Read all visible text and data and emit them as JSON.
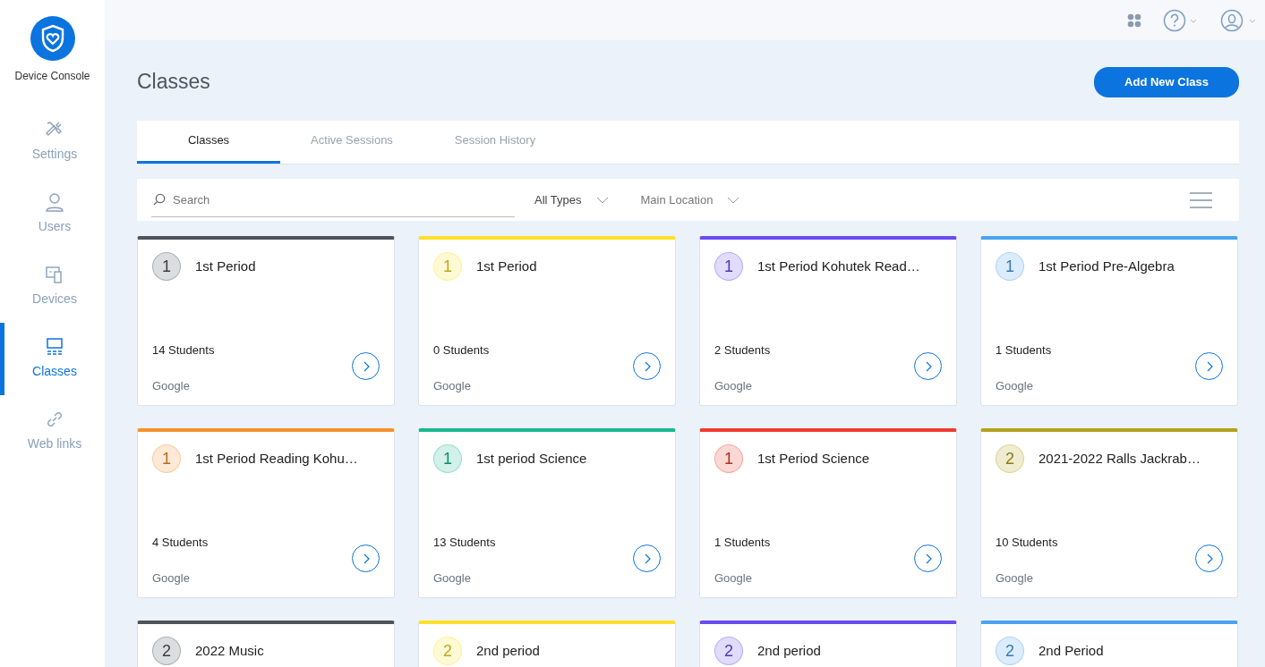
{
  "brand": {
    "name": "Device Console"
  },
  "sidebar": {
    "items": [
      {
        "label": "Settings",
        "selected": false
      },
      {
        "label": "Users",
        "selected": false
      },
      {
        "label": "Devices",
        "selected": false
      },
      {
        "label": "Classes",
        "selected": true
      },
      {
        "label": "Web links",
        "selected": false
      }
    ]
  },
  "page_title": "Classes",
  "add_button": "Add New Class",
  "tabs": [
    {
      "label": "Classes",
      "selected": true
    },
    {
      "label": "Active Sessions",
      "selected": false
    },
    {
      "label": "Session History",
      "selected": false
    }
  ],
  "filters": {
    "search_placeholder": "Search",
    "type": "All Types",
    "location": "Main Location"
  },
  "classes": [
    {
      "number": "1",
      "name": "1st Period",
      "students": "14 Students",
      "provider": "Google",
      "color": "#4b545c"
    },
    {
      "number": "1",
      "name": "1st Period",
      "students": "0 Students",
      "provider": "Google",
      "color": "#fde02a"
    },
    {
      "number": "1",
      "name": "1st Period Kohutek Read…",
      "students": "2 Students",
      "provider": "Google",
      "color": "#6a4cf0"
    },
    {
      "number": "1",
      "name": "1st Period Pre-Algebra",
      "students": "1 Students",
      "provider": "Google",
      "color": "#4aa3f0"
    },
    {
      "number": "1",
      "name": "1st Period Reading Kohu…",
      "students": "4 Students",
      "provider": "Google",
      "color": "#f7912b"
    },
    {
      "number": "1",
      "name": "1st period Science",
      "students": "13 Students",
      "provider": "Google",
      "color": "#17b890"
    },
    {
      "number": "1",
      "name": "1st Period Science",
      "students": "1 Students",
      "provider": "Google",
      "color": "#ef3b2f"
    },
    {
      "number": "2",
      "name": "2021-2022 Ralls Jackrab…",
      "students": "10 Students",
      "provider": "Google",
      "color": "#b5a21a"
    },
    {
      "number": "2",
      "name": "2022 Music",
      "color": "#4b545c"
    },
    {
      "number": "2",
      "name": "2nd period",
      "color": "#fde02a"
    },
    {
      "number": "2",
      "name": "2nd period",
      "color": "#6a4cf0"
    },
    {
      "number": "2",
      "name": "2nd Period",
      "color": "#4aa3f0"
    }
  ]
}
